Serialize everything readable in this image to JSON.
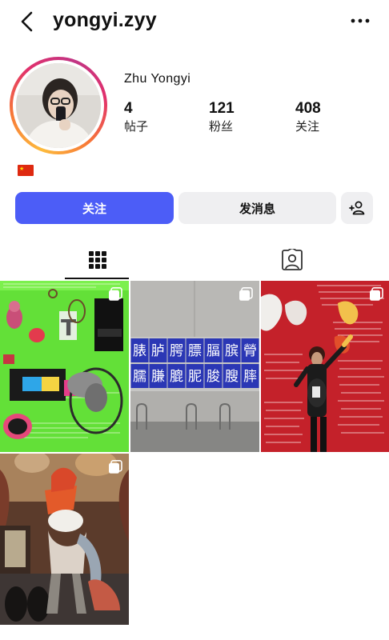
{
  "header": {
    "username": "yongyi.zyy",
    "back_icon": "chevron-left-icon",
    "more_icon": "more-horizontal-icon"
  },
  "profile": {
    "display_name": "Zhu Yongyi",
    "stats": [
      {
        "value": "4",
        "label": "帖子"
      },
      {
        "value": "121",
        "label": "粉丝"
      },
      {
        "value": "408",
        "label": "关注"
      }
    ],
    "bio_emoji": "china-flag"
  },
  "actions": {
    "follow_label": "关注",
    "message_label": "发消息",
    "add_user_icon": "add-user-icon"
  },
  "tabs": [
    {
      "name": "posts",
      "icon": "grid-icon",
      "active": true
    },
    {
      "name": "tagged",
      "icon": "tagged-person-icon",
      "active": false
    }
  ],
  "posts": [
    {
      "id": "post-1",
      "multi": true,
      "characters": "",
      "colors": [
        "#6ee63d",
        "#111111",
        "#e83a5a"
      ]
    },
    {
      "id": "post-2",
      "multi": true,
      "characters": [
        "脿",
        "胪",
        "腭",
        "膘",
        "腷",
        "膑",
        "膋",
        "臑",
        "膁",
        "膍",
        "胒",
        "朘",
        "膄",
        "膟"
      ],
      "colors": [
        "#2b37b5",
        "#9a9a9a"
      ]
    },
    {
      "id": "post-3",
      "multi": true,
      "characters": "",
      "colors": [
        "#c8222b",
        "#ffffff"
      ]
    },
    {
      "id": "post-4",
      "multi": true,
      "characters": "",
      "colors": [
        "#3b2a22",
        "#e3572a"
      ]
    }
  ],
  "accent_colors": {
    "follow_button": "#4c5df7",
    "secondary_button": "#efeff1"
  }
}
